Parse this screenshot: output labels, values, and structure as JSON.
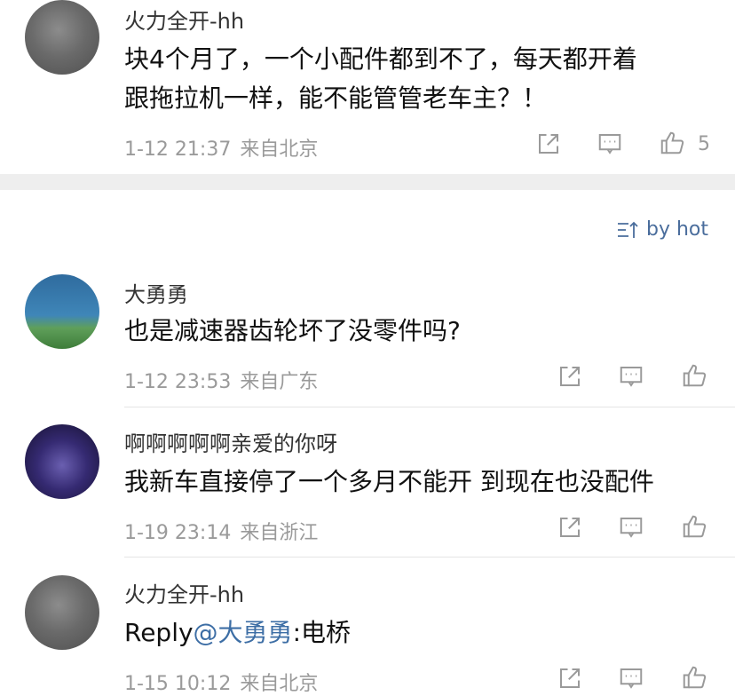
{
  "colors": {
    "link": "#3d6ea5",
    "meta": "#9a9a9a",
    "sort": "#4a6d9c"
  },
  "comments": [
    {
      "username": "火力全开-hh",
      "text_line1": "块4个月了，一个小配件都到不了，每天都开着",
      "text_line2": "跟拖拉机一样，能不能管管老车主？！",
      "time": "1-12 21:37",
      "location": "来自北京",
      "likes": "5"
    },
    {
      "username": "大勇勇",
      "text": "也是减速器齿轮坏了没零件吗?",
      "time": "1-12 23:53",
      "location": "来自广东"
    },
    {
      "username": "啊啊啊啊啊亲爱的你呀",
      "text": "我新车直接停了一个多月不能开 到现在也没配件",
      "time": "1-19 23:14",
      "location": "来自浙江"
    },
    {
      "username": "火力全开-hh",
      "reply_prefix": "Reply",
      "mention": "@大勇勇",
      "reply_text": ":电桥",
      "time": "1-15 10:12",
      "location": "来自北京"
    }
  ],
  "sort": {
    "label": "by hot",
    "icon": "sort-icon"
  },
  "icons": {
    "share": "share-icon",
    "comment": "comment-icon",
    "like": "thumbs-up-icon"
  }
}
